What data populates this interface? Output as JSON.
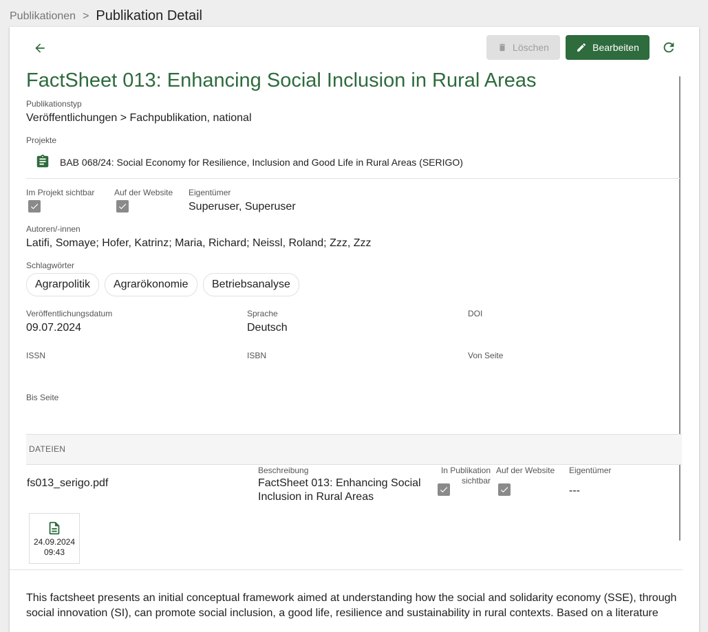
{
  "breadcrumb": {
    "parent": "Publikationen",
    "separator": ">",
    "current": "Publikation Detail"
  },
  "toolbar": {
    "delete_label": "Löschen",
    "edit_label": "Bearbeiten"
  },
  "publication": {
    "title": "FactSheet 013: Enhancing Social Inclusion in Rural Areas",
    "type_label": "Publikationstyp",
    "type_value": "Veröffentlichungen > Fachpublikation, national",
    "projects_label": "Projekte",
    "project": "BAB 068/24: Social Economy for Resilience, Inclusion and Good Life in Rural Areas (SERIGO)",
    "visible_project_label": "Im Projekt sichtbar",
    "visible_website_label": "Auf der Website",
    "owner_label": "Eigentümer",
    "owner_value": "Superuser, Superuser",
    "authors_label": "Autoren/-innen",
    "authors_value": "Latifi, Somaye; Hofer, Katrinz; Maria, Richard; Neissl, Roland; Zzz, Zzz",
    "keywords_label": "Schlagwörter",
    "keywords": [
      "Agrarpolitik",
      "Agrarökonomie",
      "Betriebsanalyse"
    ],
    "date_label": "Veröffentlichungsdatum",
    "date_value": "09.07.2024",
    "language_label": "Sprache",
    "language_value": "Deutsch",
    "doi_label": "DOI",
    "issn_label": "ISSN",
    "isbn_label": "ISBN",
    "from_page_label": "Von Seite",
    "to_page_label": "Bis Seite"
  },
  "files": {
    "header": "DATEIEN",
    "filename": "fs013_serigo.pdf",
    "description_label": "Beschreibung",
    "description_line1": "FactSheet 013: Enhancing Social",
    "description_line2": "Inclusion in Rural Areas",
    "in_publication_label_1": "In Publikation",
    "in_publication_label_2": "sichtbar",
    "website_label": "Auf der Website",
    "owner_label": "Eigentümer",
    "owner_value": "---",
    "tile_date": "24.09.2024",
    "tile_time": "09:43"
  },
  "abstract": "This factsheet presents an initial conceptual framework aimed at understanding how the social and solidarity economy (SSE), through social innovation (SI), can promote social inclusion, a good life, resilience and sustainability in rural contexts. Based on a literature",
  "icons": {
    "back": "arrow-left-icon",
    "delete": "trash-icon",
    "edit": "pencil-icon",
    "refresh": "refresh-icon",
    "project": "clipboard-icon",
    "file": "document-icon"
  },
  "colors": {
    "accent": "#2e6b3d",
    "checkbox": "#8a8a8a"
  }
}
